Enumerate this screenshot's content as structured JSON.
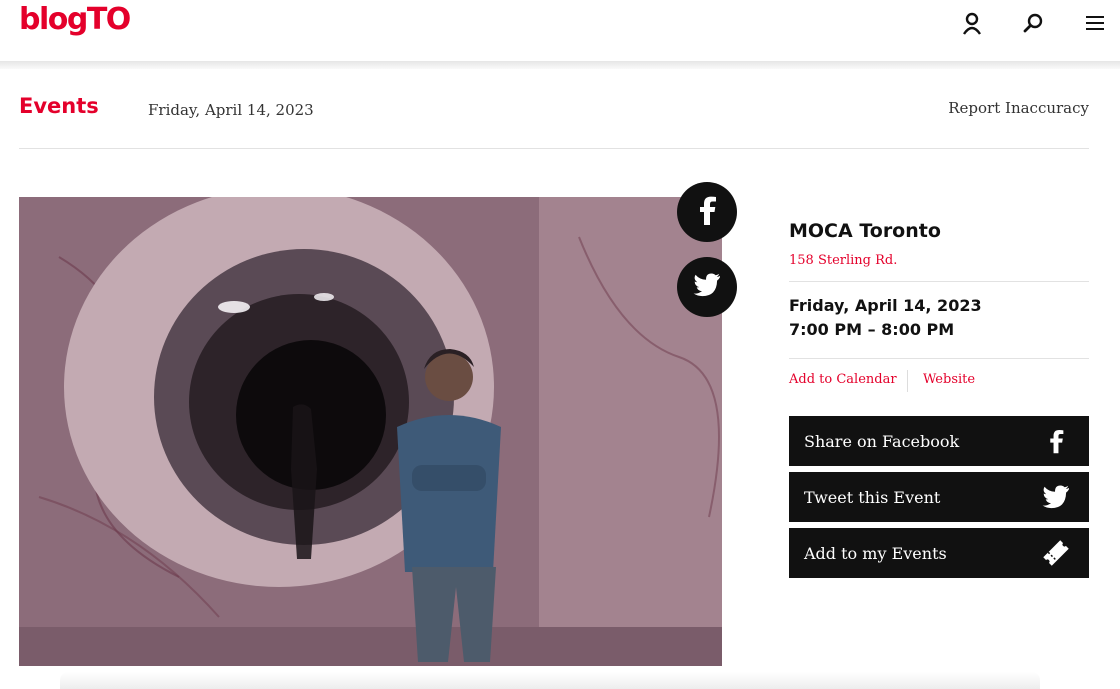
{
  "header": {
    "logo_text": "blogTO",
    "brand_color": "#e4002b",
    "icons": [
      "user-icon",
      "search-icon",
      "menu-icon"
    ]
  },
  "meta": {
    "section": "Events",
    "date": "Friday, April 14, 2023",
    "report_link": "Report Inaccuracy"
  },
  "event": {
    "venue": "MOCA Toronto",
    "address": "158 Sterling Rd.",
    "date": "Friday, April 14, 2023",
    "time": "7:00 PM – 8:00 PM",
    "add_to_calendar": "Add to Calendar",
    "website": "Website"
  },
  "share_circles": [
    "facebook-icon",
    "twitter-icon"
  ],
  "actions": {
    "share_facebook": "Share on Facebook",
    "tweet": "Tweet this Event",
    "add_my_events": "Add to my Events"
  }
}
